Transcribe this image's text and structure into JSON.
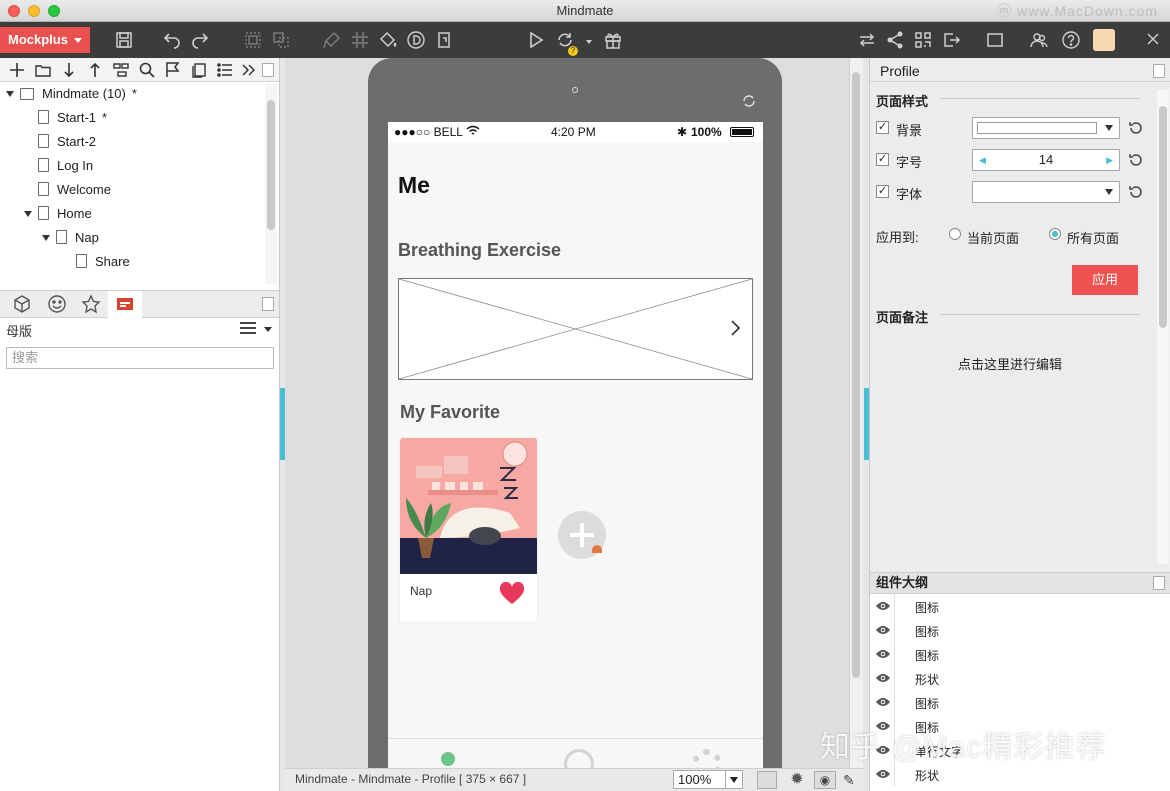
{
  "window": {
    "title": "Mindmate",
    "watermark": "ⓜ www.MacDown.com"
  },
  "toolbar": {
    "brand": "Mockplus"
  },
  "tree": [
    {
      "label": "Mindmate (10)",
      "mark": "*",
      "depth": 0,
      "expanded": true,
      "kind": "project"
    },
    {
      "label": "Start-1",
      "mark": "*",
      "depth": 1,
      "kind": "page"
    },
    {
      "label": "Start-2",
      "mark": "",
      "depth": 1,
      "kind": "page"
    },
    {
      "label": "Log In",
      "mark": "",
      "depth": 1,
      "kind": "page"
    },
    {
      "label": "Welcome",
      "mark": "",
      "depth": 1,
      "kind": "page"
    },
    {
      "label": "Home",
      "mark": "",
      "depth": 1,
      "expanded": true,
      "kind": "page"
    },
    {
      "label": "Nap",
      "mark": "",
      "depth": 2,
      "expanded": true,
      "kind": "page"
    },
    {
      "label": "Share",
      "mark": "",
      "depth": 3,
      "kind": "page"
    }
  ],
  "left_panel": {
    "master_label": "母版",
    "search_placeholder": "搜索"
  },
  "phone": {
    "carrier": "●●●○○ BELL",
    "time": "4:20 PM",
    "battery": "100%",
    "title": "Me",
    "breathing_title": "Breathing Exercise",
    "favorite_title": "My Favorite",
    "card_label": "Nap"
  },
  "statusline": {
    "path": "Mindmate - Mindmate - Profile [ 375 × 667 ]",
    "zoom": "100%"
  },
  "right_panel": {
    "header": "Profile",
    "page_style_title": "页面样式",
    "rows": [
      {
        "label": "背景",
        "value": ""
      },
      {
        "label": "字号",
        "value": "14"
      },
      {
        "label": "字体",
        "value": ""
      }
    ],
    "apply_to_label": "应用到:",
    "radio_current": "当前页面",
    "radio_all": "所有页面",
    "apply_button": "应用",
    "notes_title": "页面备注",
    "notes_edit": "点击这里进行编辑"
  },
  "outline": {
    "title": "组件大纲",
    "items": [
      "图标",
      "图标",
      "图标",
      "形状",
      "图标",
      "图标",
      "单行文字",
      "形状"
    ]
  },
  "watermark_bottom": "知乎 @Mac精彩推荐",
  "colors": {
    "brand": "#e9504f",
    "accent": "#48bfd3",
    "apply": "#ee5352",
    "heart": "#e8395d"
  }
}
